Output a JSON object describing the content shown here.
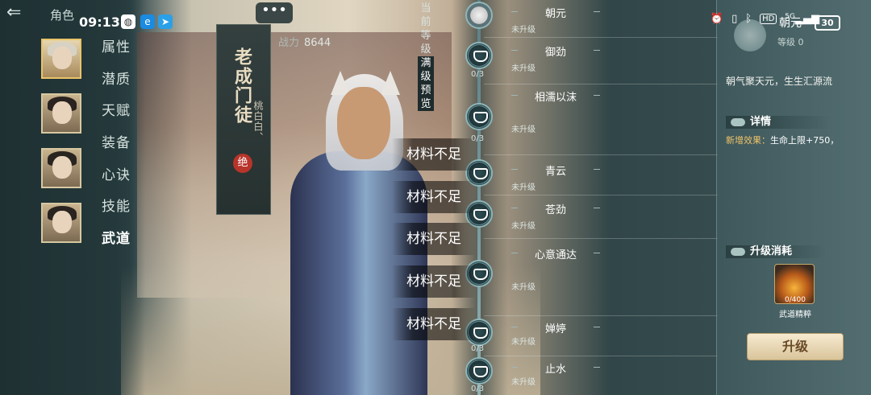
{
  "status": {
    "time": "09:13",
    "hd_badge": "HD",
    "network": "5G",
    "battery": "30"
  },
  "header": {
    "title": "角色"
  },
  "left_menu": [
    {
      "label": "属性",
      "active": false
    },
    {
      "label": "潜质",
      "active": false
    },
    {
      "label": "天赋",
      "active": false
    },
    {
      "label": "装备",
      "active": false
    },
    {
      "label": "心诀",
      "active": false
    },
    {
      "label": "技能",
      "active": false
    },
    {
      "label": "武道",
      "active": true
    }
  ],
  "character": {
    "title": "老成门徒",
    "subtitle": "桃白白、",
    "seal": "绝",
    "power_label": "战力",
    "power_value": "8644",
    "chat_bubble": "•••"
  },
  "toasts": [
    "材料不足",
    "材料不足",
    "材料不足",
    "材料不足",
    "材料不足"
  ],
  "side_tabs": [
    "当前等级",
    "满级预览"
  ],
  "skills": [
    {
      "name": "朝元",
      "status": "未升级",
      "count": "0/3"
    },
    {
      "name": "御劲",
      "status": "未升级",
      "count": "0/3"
    },
    {
      "name": "相濡以沫",
      "status": "未升级",
      "count": "0/3"
    },
    {
      "name": "青云",
      "status": "未升级",
      "count": "0/3"
    },
    {
      "name": "苍劲",
      "status": "未升级",
      "count": "0/3"
    },
    {
      "name": "心意通达",
      "status": "未升级",
      "count": "0/3"
    },
    {
      "name": "婵婷",
      "status": "未升级",
      "count": "0/3"
    },
    {
      "name": "止水",
      "status": "未升级",
      "count": "0/3"
    }
  ],
  "detail_panel": {
    "title": "朝元",
    "level": "等级 0",
    "description": "朝气聚天元，生生汇源流",
    "details_heading": "详情",
    "effect_label": "新增效果：",
    "effect_value": "生命上限+750，",
    "cost_heading": "升级消耗",
    "item_count": "0/400",
    "item_name": "武道精粹",
    "upgrade_button": "升级"
  }
}
